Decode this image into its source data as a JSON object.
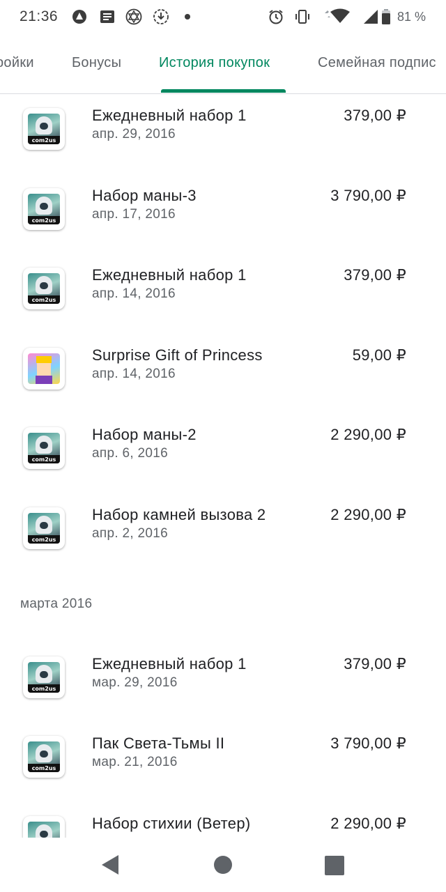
{
  "status_bar": {
    "time": "21:36",
    "battery_percent": "81 %",
    "icons": [
      "assistant-icon",
      "news-icon",
      "star-of-david-icon",
      "download-icon",
      "dot-icon",
      "alarm-icon",
      "vibrate-icon",
      "wifi-icon",
      "signal-icon",
      "battery-icon"
    ]
  },
  "tabs": [
    {
      "label": "ройки",
      "active": false
    },
    {
      "label": "Бонусы",
      "active": false
    },
    {
      "label": "История покупок",
      "active": true
    },
    {
      "label": "Семейная подпис",
      "active": false
    }
  ],
  "accent_color": "#01875f",
  "purchases_april": [
    {
      "title": "Ежедневный набор 1",
      "date": "апр. 29, 2016",
      "price": "379,00 ₽",
      "icon": "summoners-war-app-icon"
    },
    {
      "title": "Набор маны-3",
      "date": "апр. 17, 2016",
      "price": "3 790,00 ₽",
      "icon": "summoners-war-app-icon"
    },
    {
      "title": "Ежедневный набор 1",
      "date": "апр. 14, 2016",
      "price": "379,00 ₽",
      "icon": "summoners-war-app-icon"
    },
    {
      "title": "Surprise Gift of Princess",
      "date": "апр. 14, 2016",
      "price": "59,00 ₽",
      "icon": "princess-game-app-icon"
    },
    {
      "title": "Набор маны-2",
      "date": "апр. 6, 2016",
      "price": "2 290,00 ₽",
      "icon": "summoners-war-app-icon"
    },
    {
      "title": "Набор камней вызова 2",
      "date": "апр. 2, 2016",
      "price": "2 290,00 ₽",
      "icon": "summoners-war-app-icon"
    }
  ],
  "section_march": "марта 2016",
  "purchases_march": [
    {
      "title": "Ежедневный набор 1",
      "date": "мар. 29, 2016",
      "price": "379,00 ₽",
      "icon": "summoners-war-app-icon"
    },
    {
      "title": "Пак Света-Тьмы II",
      "date": "мар. 21, 2016",
      "price": "3 790,00 ₽",
      "icon": "summoners-war-app-icon"
    },
    {
      "title": "Набор стихии (Ветер)",
      "date": "",
      "price": "2 290,00 ₽",
      "icon": "summoners-war-app-icon"
    }
  ],
  "thumb_logo_text": "com2us"
}
